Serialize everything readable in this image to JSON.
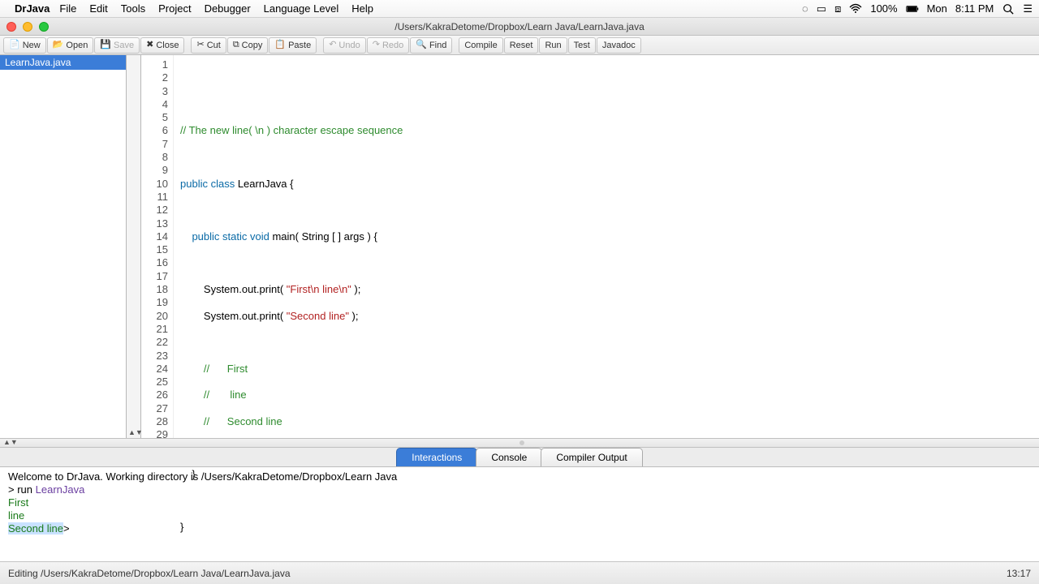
{
  "menubar": {
    "app": "DrJava",
    "items": [
      "File",
      "Edit",
      "Tools",
      "Project",
      "Debugger",
      "Language Level",
      "Help"
    ],
    "battery": "100%",
    "day": "Mon",
    "time": "8:11 PM"
  },
  "titlebar": {
    "path": "/Users/KakraDetome/Dropbox/Learn Java/LearnJava.java"
  },
  "toolbar": {
    "new": "New",
    "open": "Open",
    "save": "Save",
    "close": "Close",
    "cut": "Cut",
    "copy": "Copy",
    "paste": "Paste",
    "undo": "Undo",
    "redo": "Redo",
    "find": "Find",
    "compile": "Compile",
    "reset": "Reset",
    "run": "Run",
    "test": "Test",
    "javadoc": "Javadoc"
  },
  "filelist": {
    "file": "LearnJava.java"
  },
  "code": {
    "l1": "",
    "l2": "",
    "l3c": "// The new line( \\n ) character escape sequence",
    "l4": "",
    "l5a": "public",
    "l5b": " class",
    "l5c": " LearnJava {",
    "l6": "",
    "l7a": "    public",
    "l7b": " static",
    "l7c": " void",
    "l7d": " main( String [ ] args ) {",
    "l8": "",
    "l9a": "        System.out.print( ",
    "l9b": "\"First\\n line\\n\"",
    "l9c": " );",
    "l10a": "        System.out.print( ",
    "l10b": "\"Second line\"",
    "l10c": " );",
    "l11": "",
    "l12": "        //      First",
    "l13": "        //       line",
    "l14": "        //      Second line",
    "l15": "",
    "l16": "    }",
    "l17": "",
    "l18": "}",
    "max_line": 29
  },
  "tabs": {
    "interactions": "Interactions",
    "console": "Console",
    "compiler": "Compiler Output"
  },
  "console": {
    "welcome": "Welcome to DrJava.  Working directory is /Users/KakraDetome/Dropbox/Learn Java",
    "prompt": "> ",
    "run_kw": "run ",
    "run_cls": "LearnJava",
    "out1": "First",
    "out2": " line",
    "out3": "Second line",
    "caret": ">"
  },
  "status": {
    "left": "Editing /Users/KakraDetome/Dropbox/Learn Java/LearnJava.java",
    "right": "13:17"
  }
}
